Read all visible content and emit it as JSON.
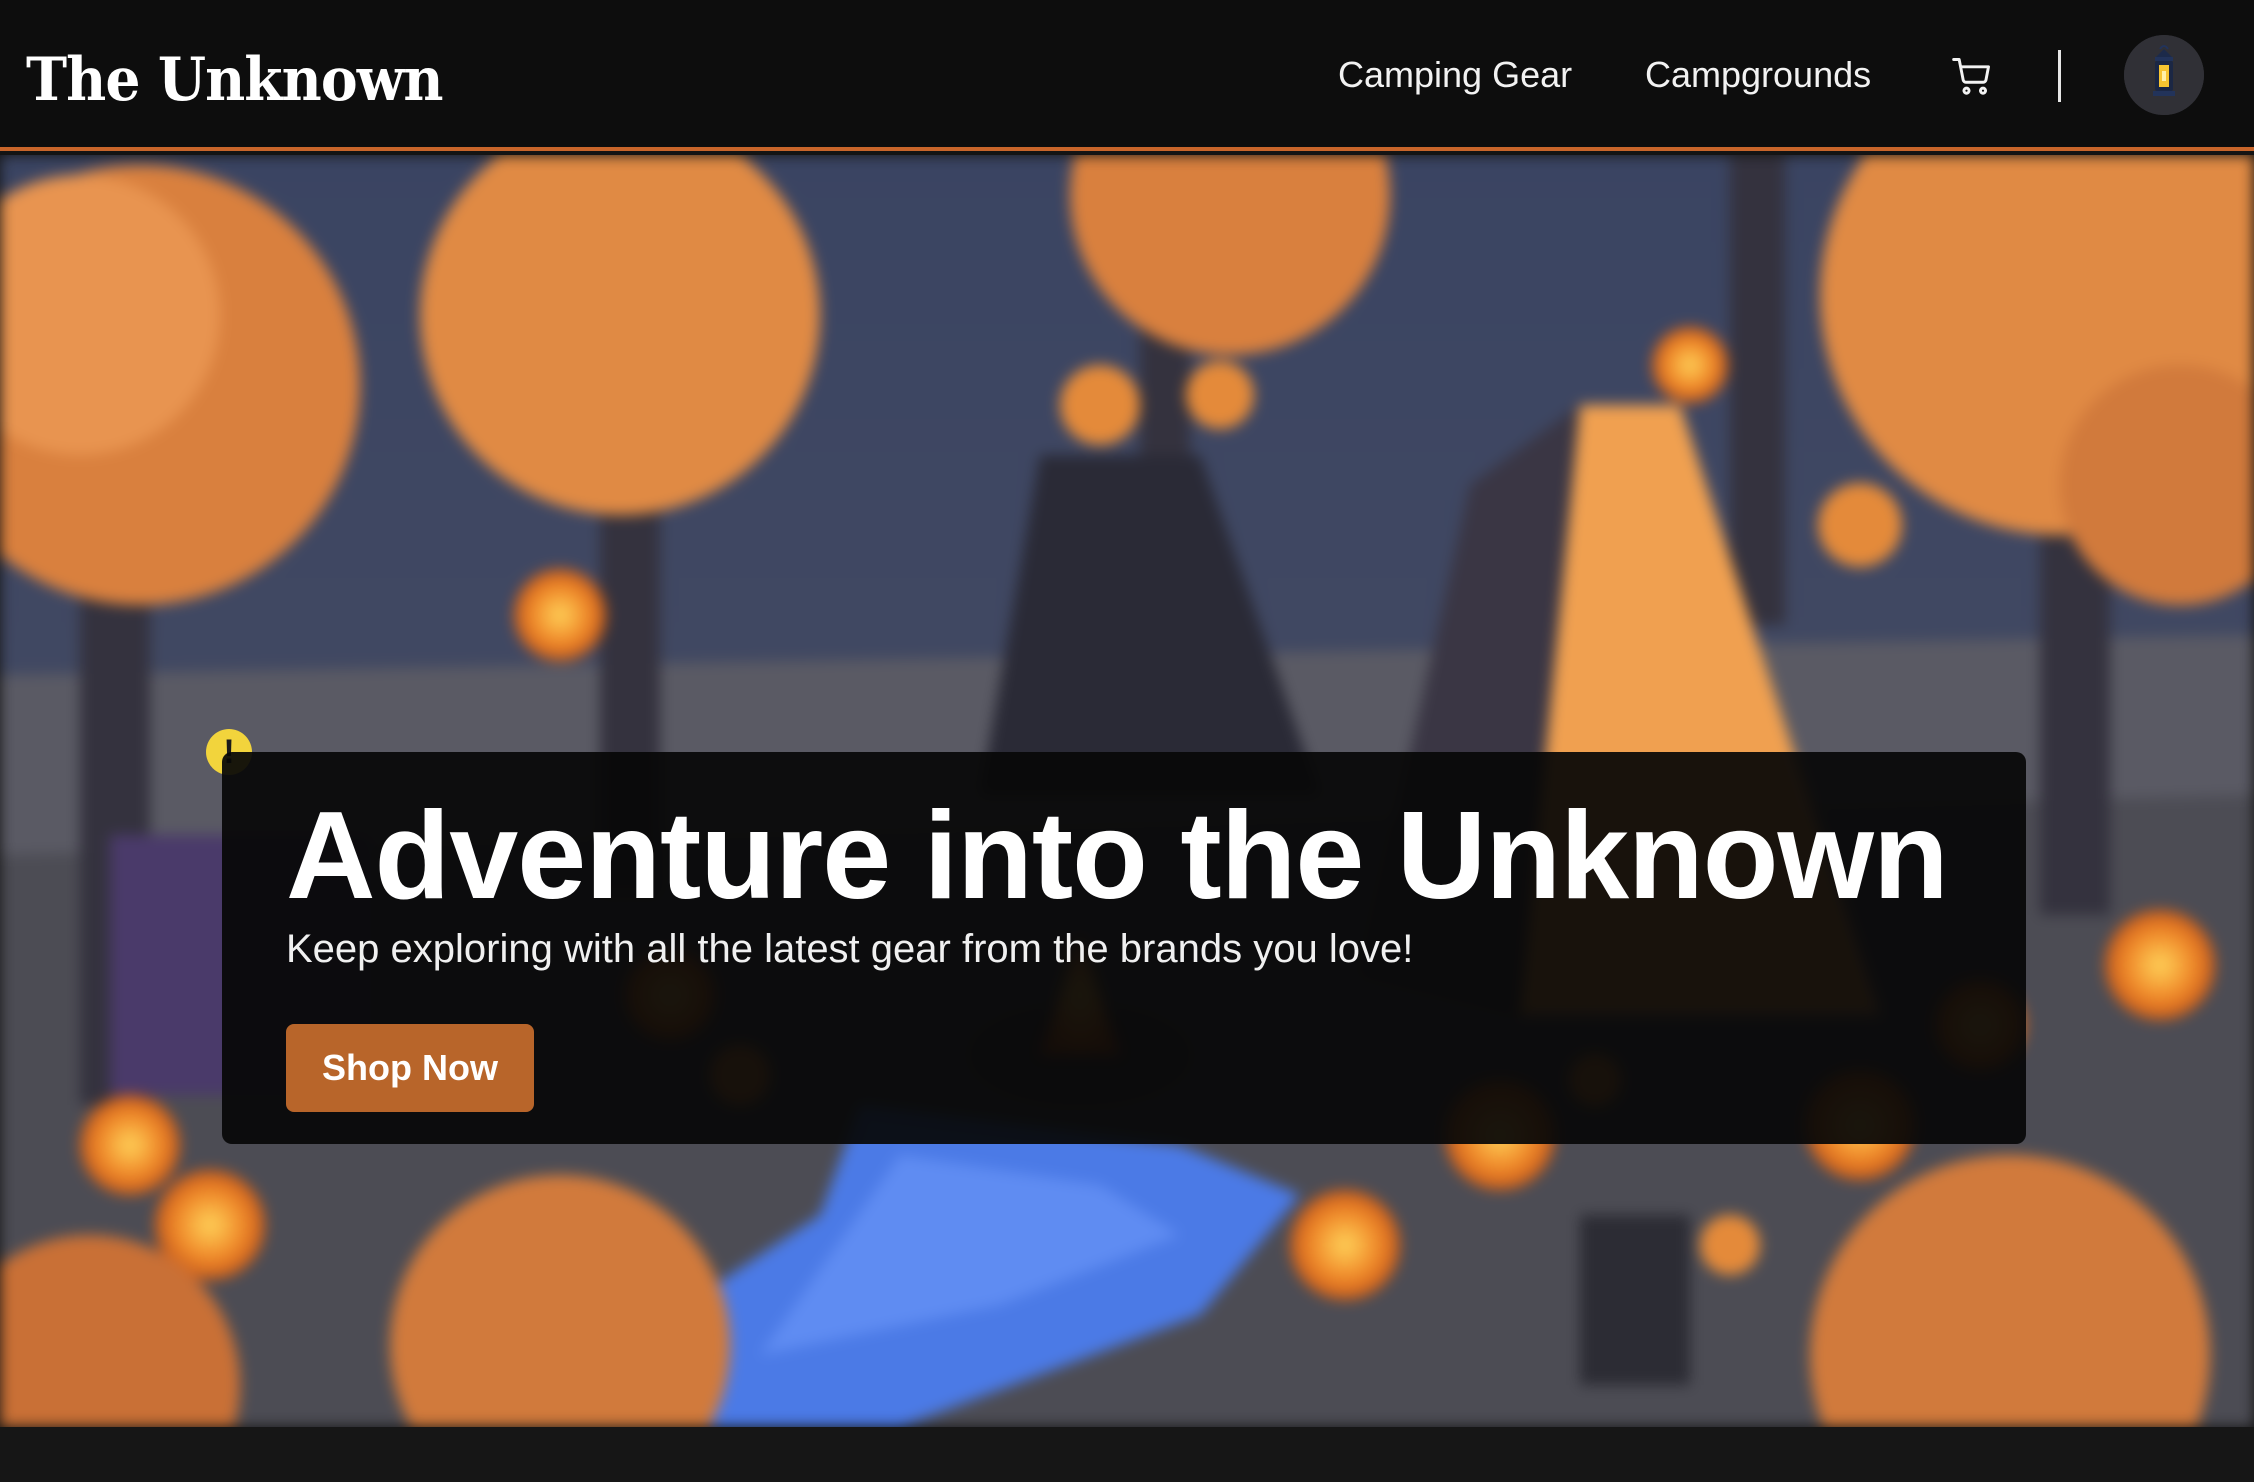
{
  "header": {
    "brand": "The Unknown",
    "nav": [
      {
        "label": "Camping Gear"
      },
      {
        "label": "Campgrounds"
      }
    ],
    "cart_icon": "cart-icon",
    "avatar_icon": "lantern-icon"
  },
  "hero": {
    "title": "Adventure into the Unknown",
    "subtitle": "Keep exploring with all the latest gear from the brands you love!",
    "cta_label": "Shop Now",
    "warning_glyph": "!"
  },
  "colors": {
    "accent": "#c8652a",
    "button": "#b8652a",
    "header_bg": "#0d0d0d",
    "overlay_bg": "#080808",
    "warning": "#f2d43c"
  }
}
